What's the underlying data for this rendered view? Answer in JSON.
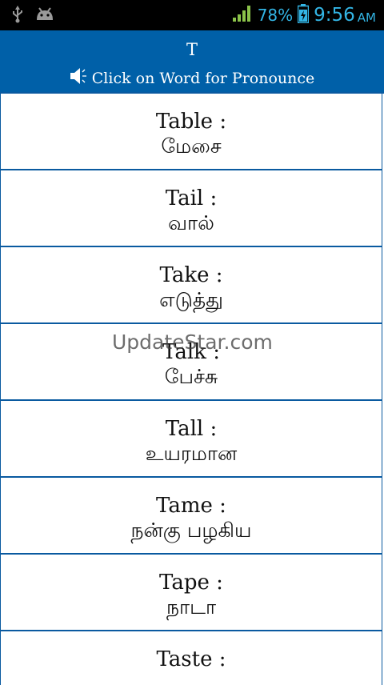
{
  "status_bar": {
    "battery_percent": "78%",
    "time": "9:56",
    "ampm": "AM",
    "icons": [
      "usb-icon",
      "android-icon",
      "signal-icon",
      "battery-icon"
    ],
    "accent": "#33b5e5"
  },
  "header": {
    "title": "T",
    "hint": "Click on Word for Pronounce",
    "background": "#0060a8"
  },
  "words": [
    {
      "en": "Table :",
      "ta": "மேசை"
    },
    {
      "en": "Tail :",
      "ta": "வால்"
    },
    {
      "en": "Take :",
      "ta": "எடுத்து"
    },
    {
      "en": "Talk :",
      "ta": "பேச்சு"
    },
    {
      "en": "Tall :",
      "ta": "உயரமான"
    },
    {
      "en": "Tame :",
      "ta": "நன்கு பழகிய"
    },
    {
      "en": "Tape :",
      "ta": "நாடா"
    },
    {
      "en": "Taste :",
      "ta": ""
    }
  ],
  "watermark": "UpdateStar.com"
}
